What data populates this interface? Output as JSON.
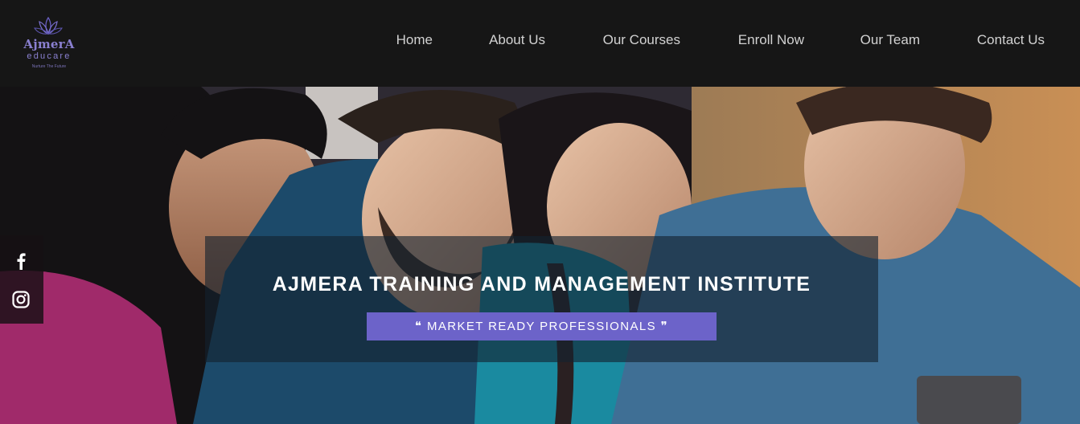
{
  "brand": {
    "name": "AjmerA",
    "sub": "educare",
    "tagline": "Nurture The Future",
    "logo_icon": "lotus-icon",
    "color": "#8a80d0"
  },
  "nav": {
    "items": [
      {
        "label": "Home"
      },
      {
        "label": "About Us"
      },
      {
        "label": "Our Courses"
      },
      {
        "label": "Enroll Now"
      },
      {
        "label": "Our Team"
      },
      {
        "label": "Contact Us"
      }
    ]
  },
  "hero": {
    "title": "AJMERA TRAINING AND MANAGEMENT INSTITUTE",
    "badge": "❝ MARKET READY PROFESSIONALS ❞",
    "badge_color": "#6c63c9",
    "image": "four-students-smiling-at-laptop"
  },
  "social": {
    "items": [
      {
        "icon": "facebook-icon"
      },
      {
        "icon": "instagram-icon"
      }
    ]
  },
  "colors": {
    "nav_background": "#161616",
    "nav_text": "#d2d2d2"
  }
}
